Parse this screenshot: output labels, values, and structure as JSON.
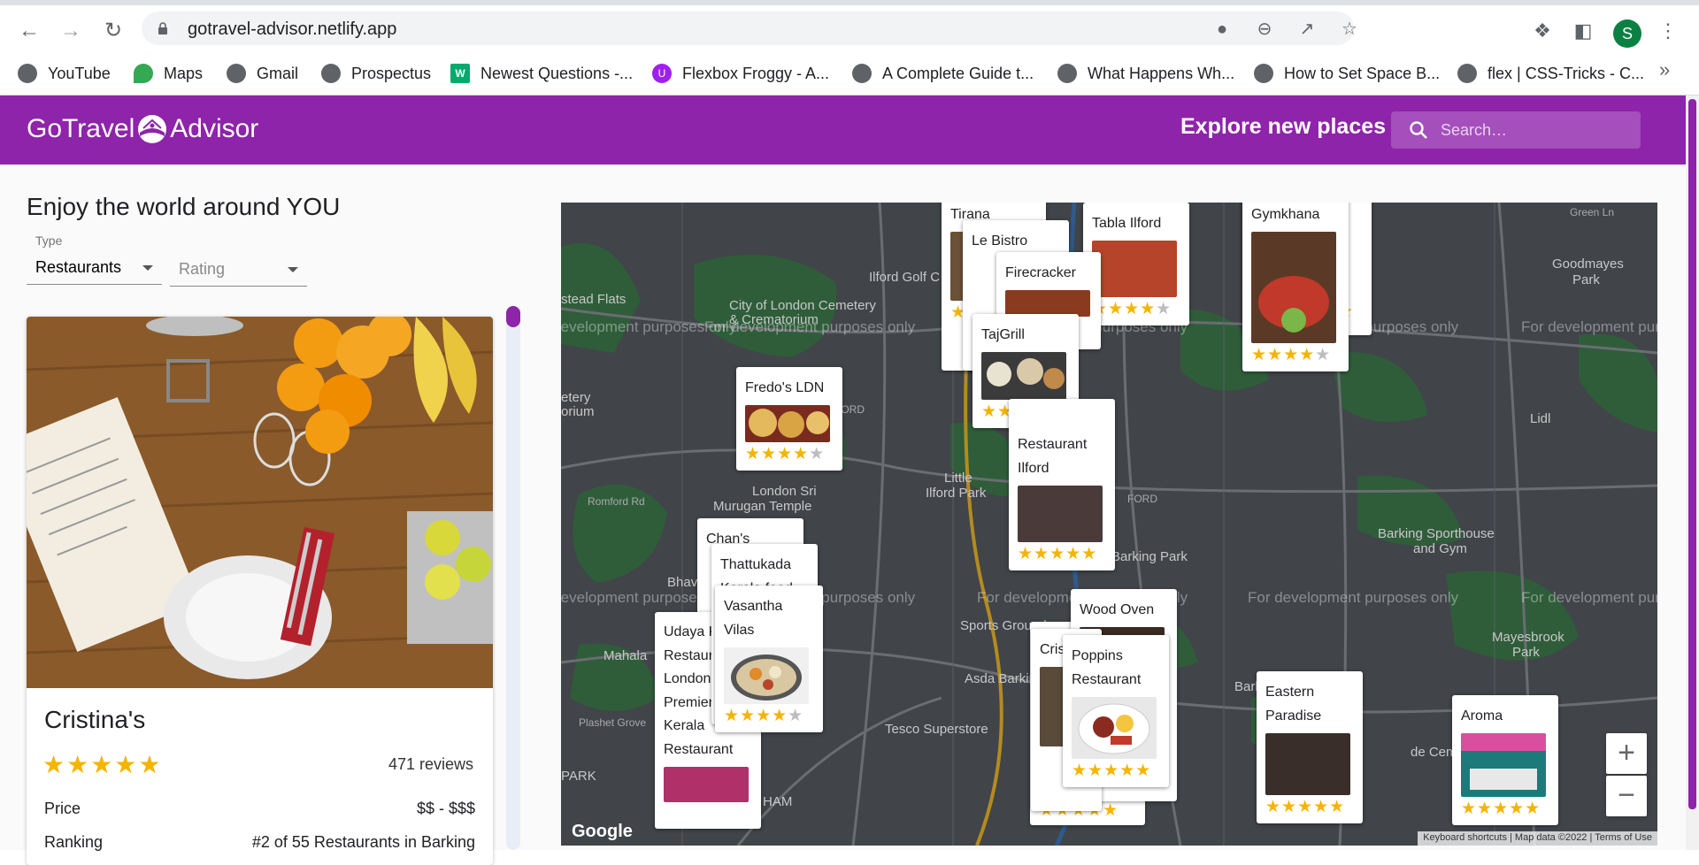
{
  "browser": {
    "url": "gotravel-advisor.netlify.app",
    "profile_initial": "S",
    "bookmarks": [
      {
        "label": "YouTube",
        "icon": "globe-icon"
      },
      {
        "label": "Maps",
        "icon": "maps-pin-icon"
      },
      {
        "label": "Gmail",
        "icon": "globe-icon"
      },
      {
        "label": "Prospectus",
        "icon": "globe-icon"
      },
      {
        "label": "Newest Questions -...",
        "icon": "w3-icon"
      },
      {
        "label": "Flexbox Froggy - A...",
        "icon": "froggy-icon"
      },
      {
        "label": "A Complete Guide t...",
        "icon": "globe-icon"
      },
      {
        "label": "What Happens Wh...",
        "icon": "globe-icon"
      },
      {
        "label": "How to Set Space B...",
        "icon": "globe-icon"
      },
      {
        "label": "flex | CSS-Tricks - C...",
        "icon": "globe-icon"
      }
    ],
    "more": "»"
  },
  "header": {
    "logo_left": "GoTravel",
    "logo_right": "Advisor",
    "explore": "Explore new places",
    "search_placeholder": "Search…"
  },
  "sidebar": {
    "heading": "Enjoy the world around YOU",
    "type_label": "Type",
    "type_value": "Restaurants",
    "rating_value": "Rating"
  },
  "card": {
    "name": "Cristina's",
    "stars": "★★★★★",
    "reviews": "471 reviews",
    "price_label": "Price",
    "price_value": "$$ - $$$",
    "ranking_label": "Ranking",
    "ranking_value": "#2 of 55 Restaurants in Barking"
  },
  "map": {
    "watermark": "For development purposes only",
    "labels": {
      "cemetery": "City of London Cemetery",
      "crematorium": "& Crematorium",
      "ilford_golf": "Ilford Golf C",
      "goodmayes": "Goodmayes",
      "park": "Park",
      "murugan": "London Sri",
      "murugan2": "Murugan Temple",
      "little_ilford": "Little",
      "little_ilford2": "Ilford Park",
      "barking_park": "Barking Park",
      "barking_sports": "Barking Sporthouse",
      "and_gym": "and Gym",
      "mayesbrook": "Mayesbrook",
      "tesco": "Tesco Superstore",
      "barking_hospital": "Barking Hospital",
      "lidl": "Lidl",
      "romford": "Romford Rd",
      "plashet": "Plashet Grove",
      "green_ln": "Green Ln",
      "de_cemetery": "de Cemetery",
      "sports_ground": "Sports Ground",
      "park_label": "PARK",
      "ham": "HAM",
      "mahala": "Mahala",
      "bhav": "Bhav",
      "etery": "etery",
      "orium": "orium",
      "ford": "FORD",
      "iford": "FORD",
      "asbarking": "Asda Barking",
      "stead": "stead Flats"
    },
    "zoom_in": "+",
    "zoom_out": "−",
    "google": "Google",
    "footer": "Keyboard shortcuts  |  Map data ©2022  |  Terms of Use"
  },
  "pins": [
    {
      "name": "Tirana",
      "stars": "★★★★★"
    },
    {
      "name": "Tabla Ilford",
      "stars": "★★★★★"
    },
    {
      "name": "Gymkhana",
      "stars": "★★★★★"
    },
    {
      "name": "Le Bistro",
      "stars": "★★★★★"
    },
    {
      "name": "Firecracker",
      "stars": "★★★★★"
    },
    {
      "name": "TajGrill",
      "stars": "★★★★★"
    },
    {
      "name": "Fredo's LDN",
      "stars": "★★★★★"
    },
    {
      "name": "Restaurant Ilford",
      "stars": "★★★★★"
    },
    {
      "name": "Chan's",
      "stars": "★★★★★"
    },
    {
      "name": "Thattukada Kerala food",
      "stars": "★★★★★"
    },
    {
      "name": "Vasantha Vilas",
      "stars": "★★★★★"
    },
    {
      "name": "Udaya Kerala Restaurant London Premier Kerala Restaurant",
      "stars": "★★★★★"
    },
    {
      "name": "Wood Oven",
      "stars": "★★★★★"
    },
    {
      "name": "Poppins Restaurant",
      "stars": "★★★★★"
    },
    {
      "name": "Cris",
      "stars": "★★★★★"
    },
    {
      "name": "Eastern Paradise",
      "stars": "★★★★★"
    },
    {
      "name": "Aroma",
      "stars": "★★★★★"
    }
  ],
  "colors": {
    "primary": "#8e24aa",
    "star": "#f5b400",
    "map_bg": "#414449",
    "map_green": "#2f5d3a"
  }
}
